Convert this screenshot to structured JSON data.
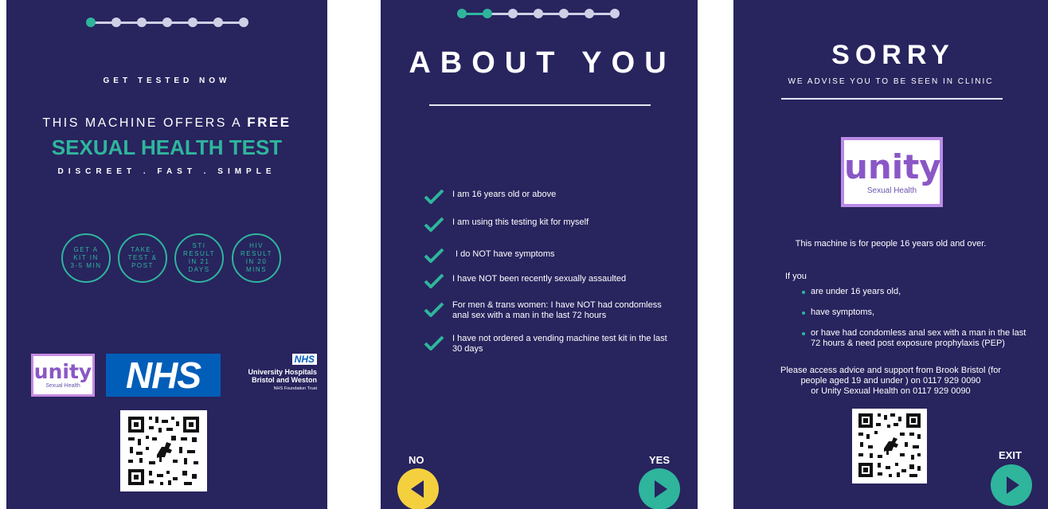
{
  "colors": {
    "panel_bg": "#28245e",
    "accent_teal": "#2fb59c",
    "yellow": "#f4d03f",
    "nhs_blue": "#005eb8"
  },
  "screen1": {
    "progress": {
      "steps": 7,
      "current": 1
    },
    "header": "GET TESTED NOW",
    "offer_prefix": "THIS MACHINE OFFERS A",
    "offer_bold": "FREE",
    "headline": "SEXUAL HEALTH TEST",
    "tagline": "DISCREET . FAST . SIMPLE",
    "circles": [
      [
        "GET A",
        "KIT IN",
        "3-5 MIN"
      ],
      [
        "TAKE,",
        "TEST &",
        "POST"
      ],
      [
        "STI",
        "RESULT",
        "IN 21",
        "DAYS"
      ],
      [
        "HIV",
        "RESULT",
        "IN 20",
        "MINS"
      ]
    ],
    "unity_logo": {
      "word": "unity",
      "sub": "Sexual Health"
    },
    "nhs_logo": "NHS",
    "trust_logo": {
      "badge": "NHS",
      "line1": "University Hospitals",
      "line2": "Bristol and Weston",
      "line3": "NHS Foundation Trust"
    },
    "qr_icon": "qr-code-icon"
  },
  "screen2": {
    "progress": {
      "steps": 7,
      "current": 2
    },
    "title": "ABOUT YOU",
    "items": [
      "I am 16 years old or above",
      "I am using this testing kit for myself",
      "I do NOT have symptoms",
      "I have NOT been recently sexually assaulted",
      "For men & trans women: I have NOT had condomless anal sex with a man in the last 72 hours",
      "I have not ordered a vending machine test kit in the last 30 days"
    ],
    "no_label": "NO",
    "yes_label": "YES"
  },
  "screen3": {
    "title": "SORRY",
    "subtitle": "WE ADVISE YOU TO BE SEEN IN CLINIC",
    "unity_logo": {
      "word": "unity",
      "sub": "Sexual Health"
    },
    "intro": "This machine is for people 16 years old and over.",
    "if_you": "If you",
    "bullets": [
      "are under 16 years old,",
      "have symptoms,",
      "or have had condomless anal sex with a man in the last 72 hours  & need post exposure prophylaxis (PEP)"
    ],
    "advice_line1": "Please access advice and support from Brook Bristol (for",
    "advice_line2": "people aged 19 and under ) on 0117 929 0090",
    "advice_line3": "or Unity Sexual Health on 0117 929 0090",
    "exit_label": "EXIT",
    "qr_icon": "qr-code-icon"
  }
}
